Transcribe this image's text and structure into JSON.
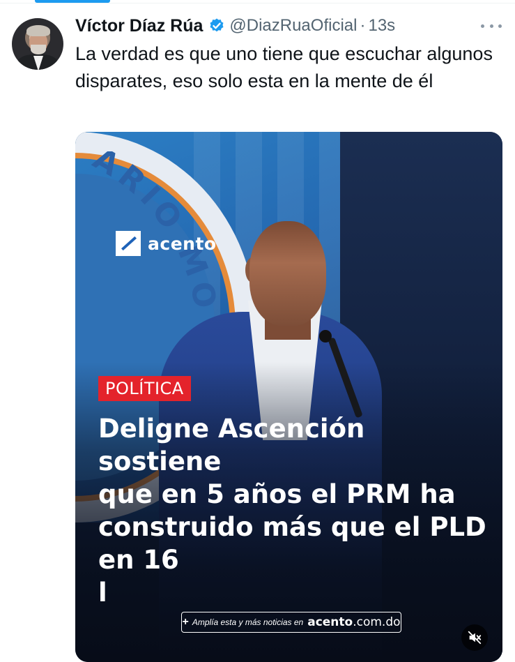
{
  "tweet": {
    "display_name": "Víctor Díaz Rúa",
    "handle": "@DiazRuaOficial",
    "separator": "·",
    "time": "13s",
    "text": "La verdad es que uno tiene que escuchar algunos disparates, eso solo esta en la mente de él"
  },
  "media": {
    "logo_text": "acento",
    "seal_text": "ARIO MO",
    "category": "POLÍTICA",
    "headline": "Deligne Ascención sostiene\nque en 5 años el PRM ha\nconstruido más que el PLD\nen 16\nl",
    "footer_plus": "+",
    "footer_text": "Amplía esta y más noticias en",
    "footer_brand": "acento",
    "footer_domain": ".com.do"
  },
  "colors": {
    "accent": "#1d9bf0",
    "category_bg": "#e4232b",
    "muted_text": "#536471"
  },
  "icons": {
    "verified": "verified-badge-icon",
    "more": "more-options-icon",
    "mute": "volume-muted-icon"
  }
}
